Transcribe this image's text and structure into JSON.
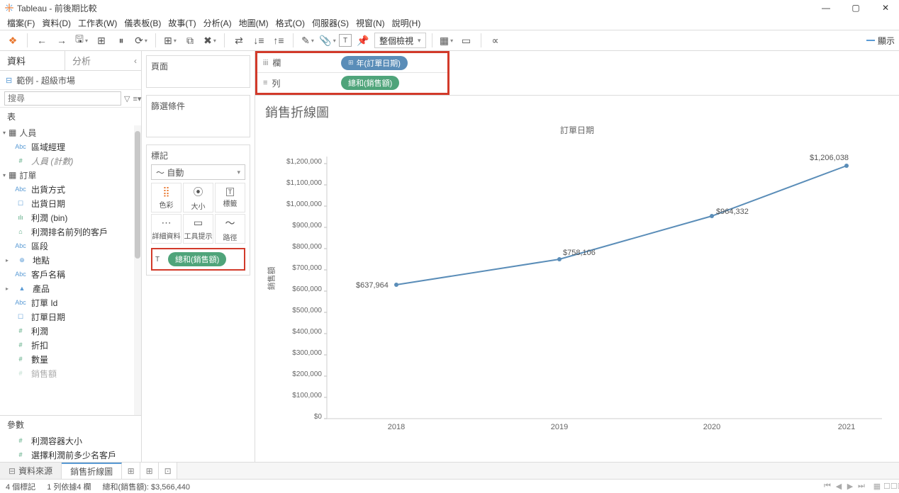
{
  "window": {
    "app": "Tableau",
    "title": "前後期比較"
  },
  "menu": [
    "檔案(F)",
    "資料(D)",
    "工作表(W)",
    "儀表板(B)",
    "故事(T)",
    "分析(A)",
    "地圖(M)",
    "格式(O)",
    "伺服器(S)",
    "視窗(N)",
    "說明(H)"
  ],
  "toolbar": {
    "view_selector": "整個檢視",
    "show_label": "顯示"
  },
  "left": {
    "tab_data": "資料",
    "tab_analysis": "分析",
    "datasource": "範例 - 超級市場",
    "search_placeholder": "搜尋",
    "tables_label": "表",
    "table1": "人員",
    "t1_fields": [
      {
        "ico": "Abc",
        "cls": "dim",
        "name": "區域經理"
      },
      {
        "ico": "#",
        "cls": "meas",
        "name": "人員 (計數)",
        "italic": true
      }
    ],
    "table2": "訂單",
    "t2_fields": [
      {
        "ico": "Abc",
        "cls": "dim",
        "name": "出貨方式"
      },
      {
        "ico": "☐",
        "cls": "dim",
        "name": "出貨日期"
      },
      {
        "ico": "ılı",
        "cls": "meas",
        "name": "利潤 (bin)"
      },
      {
        "ico": "⌂",
        "cls": "meas",
        "name": "利潤排名前列的客戶"
      },
      {
        "ico": "Abc",
        "cls": "dim",
        "name": "區段"
      },
      {
        "ico": "⊕",
        "cls": "dim",
        "name": "地點",
        "expandable": true
      },
      {
        "ico": "Abc",
        "cls": "dim",
        "name": "客戶名稱"
      },
      {
        "ico": "▲",
        "cls": "dim",
        "name": "產品",
        "expandable": true
      },
      {
        "ico": "Abc",
        "cls": "dim",
        "name": "訂單 Id"
      },
      {
        "ico": "☐",
        "cls": "dim",
        "name": "訂單日期"
      },
      {
        "ico": "#",
        "cls": "meas",
        "name": "利潤"
      },
      {
        "ico": "#",
        "cls": "meas",
        "name": "折扣"
      },
      {
        "ico": "#",
        "cls": "meas",
        "name": "數量"
      },
      {
        "ico": "#",
        "cls": "meas",
        "name": "銷售額"
      }
    ],
    "params_label": "參數",
    "params": [
      {
        "ico": "#",
        "name": "利潤容器大小"
      },
      {
        "ico": "#",
        "name": "選擇利潤前多少名客戶"
      }
    ]
  },
  "cards": {
    "pages_title": "頁面",
    "filters_title": "篩選條件",
    "marks_title": "標記",
    "mark_type": "～ 自動",
    "cells": [
      {
        "icon": "⣿",
        "label": "色彩"
      },
      {
        "icon": "⦿",
        "label": "大小"
      },
      {
        "icon": "T",
        "label": "標籤"
      },
      {
        "icon": "⋯",
        "label": "詳細資料"
      },
      {
        "icon": "▭",
        "label": "工具提示"
      },
      {
        "icon": "～",
        "label": "路徑"
      }
    ],
    "mark_pill": "總和(銷售額)"
  },
  "shelves": {
    "columns_label": "欄",
    "rows_label": "列",
    "columns_pill": "年(訂單日期)",
    "rows_pill": "總和(銷售額)"
  },
  "chart_data": {
    "type": "line",
    "title": "銷售折線圖",
    "x_title": "訂單日期",
    "y_label": "銷售額",
    "categories": [
      "2018",
      "2019",
      "2020",
      "2021"
    ],
    "values": [
      637964,
      758106,
      964332,
      1206038
    ],
    "value_labels": [
      "$637,964",
      "$758,106",
      "$964,332",
      "$1,206,038"
    ],
    "y_ticks": [
      "$0",
      "$100,000",
      "$200,000",
      "$300,000",
      "$400,000",
      "$500,000",
      "$600,000",
      "$700,000",
      "$800,000",
      "$900,000",
      "$1,000,000",
      "$1,100,000",
      "$1,200,000"
    ],
    "ylim": [
      0,
      1250000
    ]
  },
  "bottom": {
    "datasource_tab": "資料來源",
    "sheet_tab": "銷售折線圖"
  },
  "status": {
    "marks": "4 個標記",
    "rows": "1 列依據4 欄",
    "sum": "總和(銷售額): $3,566,440"
  }
}
